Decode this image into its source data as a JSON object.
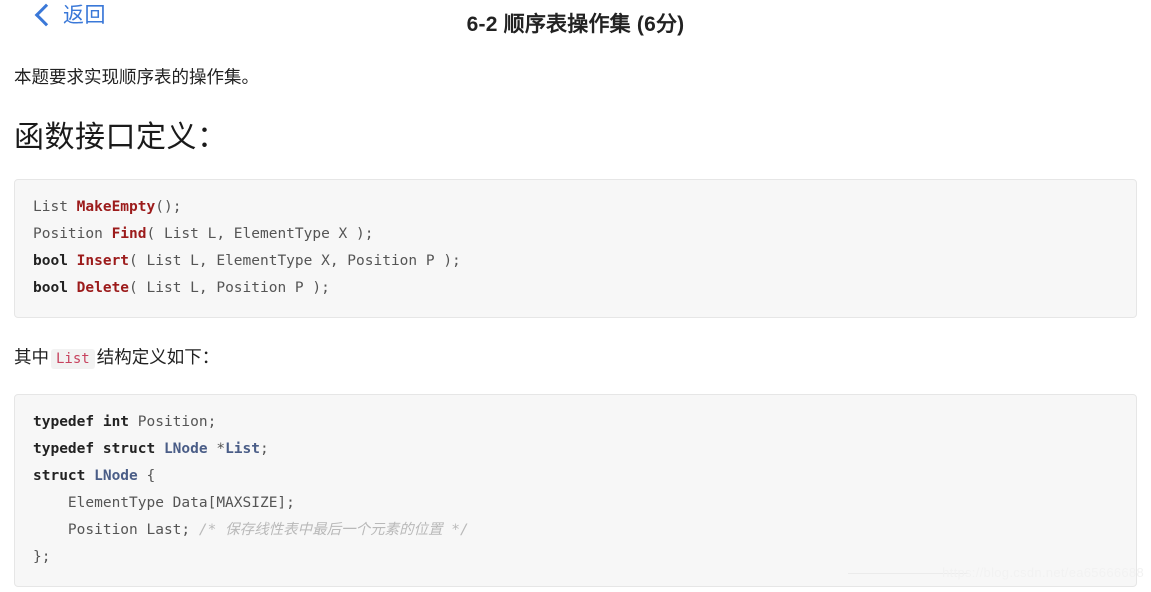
{
  "header": {
    "back_label": "返回",
    "back_icon": "chevron-left-icon",
    "title": "6-2 顺序表操作集 (6分)",
    "accent_color": "#3a78d8"
  },
  "main": {
    "intro": "本题要求实现顺序表的操作集。",
    "section_heading": "函数接口定义：",
    "interface_code": {
      "lines": [
        [
          {
            "t": "List ",
            "c": "plain"
          },
          {
            "t": "MakeEmpty",
            "c": "fn"
          },
          {
            "t": "();",
            "c": "punc"
          }
        ],
        [
          {
            "t": "Position ",
            "c": "plain"
          },
          {
            "t": "Find",
            "c": "fn"
          },
          {
            "t": "( List L, ElementType X );",
            "c": "punc"
          }
        ],
        [
          {
            "t": "bool ",
            "c": "kw"
          },
          {
            "t": "Insert",
            "c": "fn"
          },
          {
            "t": "( List L, ElementType X, Position P );",
            "c": "punc"
          }
        ],
        [
          {
            "t": "bool ",
            "c": "kw"
          },
          {
            "t": "Delete",
            "c": "fn"
          },
          {
            "t": "( List L, Position P );",
            "c": "punc"
          }
        ]
      ]
    },
    "struct_intro": {
      "before": "其中",
      "code": "List",
      "after": "结构定义如下："
    },
    "struct_code": {
      "lines": [
        [
          {
            "t": "typedef int ",
            "c": "kw"
          },
          {
            "t": "Position;",
            "c": "plain"
          }
        ],
        [
          {
            "t": "typedef struct ",
            "c": "kw"
          },
          {
            "t": "LNode",
            "c": "type"
          },
          {
            "t": " *",
            "c": "plain"
          },
          {
            "t": "List",
            "c": "type"
          },
          {
            "t": ";",
            "c": "plain"
          }
        ],
        [
          {
            "t": "struct ",
            "c": "kw"
          },
          {
            "t": "LNode",
            "c": "type"
          },
          {
            "t": " {",
            "c": "plain"
          }
        ],
        [
          {
            "t": "    ElementType Data[MAXSIZE];",
            "c": "plain"
          }
        ],
        [
          {
            "t": "    Position Last; ",
            "c": "plain"
          },
          {
            "t": "/* 保存线性表中最后一个元素的位置 */",
            "c": "cmt"
          }
        ],
        [
          {
            "t": "};",
            "c": "plain"
          }
        ]
      ]
    }
  },
  "watermark": {
    "text": "https://blog.csdn.net/ea65666688"
  }
}
